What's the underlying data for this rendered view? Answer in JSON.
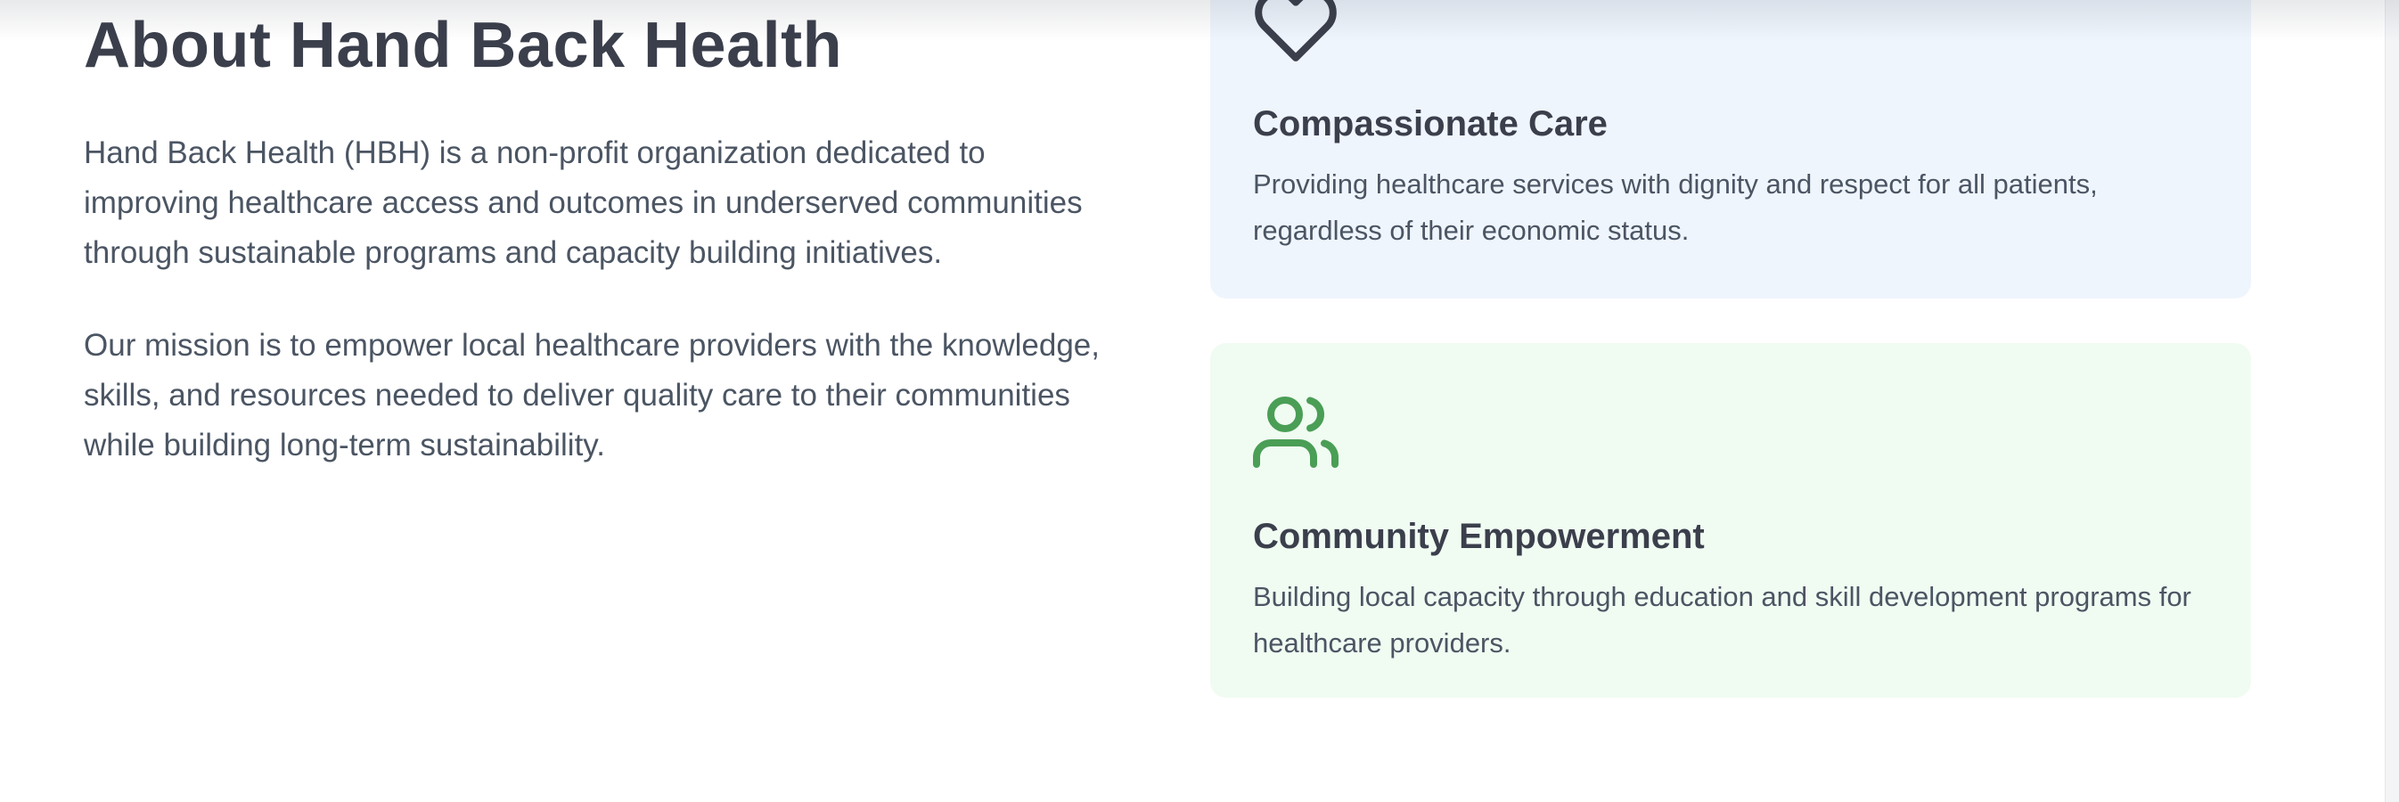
{
  "about": {
    "title": "About Hand Back Health",
    "paragraph_1": "Hand Back Health (HBH) is a non-profit organization dedicated to improving healthcare access and outcomes in underserved communities through sustainable programs and capacity building initiatives.",
    "paragraph_2": "Our mission is to empower local healthcare providers with the knowledge, skills, and resources needed to deliver quality care to their communities while building long-term sustainability."
  },
  "cards": [
    {
      "icon": "heart-icon",
      "title": "Compassionate Care",
      "description": "Providing healthcare services with dignity and respect for all patients, regardless of their economic status.",
      "background": "#eff5fd",
      "icon_color": "#3b3f4c"
    },
    {
      "icon": "users-icon",
      "title": "Community Empowerment",
      "description": "Building local capacity through education and skill development programs for healthcare providers.",
      "background": "#f0fbf2",
      "icon_color": "#4a9e55"
    }
  ],
  "colors": {
    "heading": "#3b3f4c",
    "body_text": "#4b5563"
  }
}
